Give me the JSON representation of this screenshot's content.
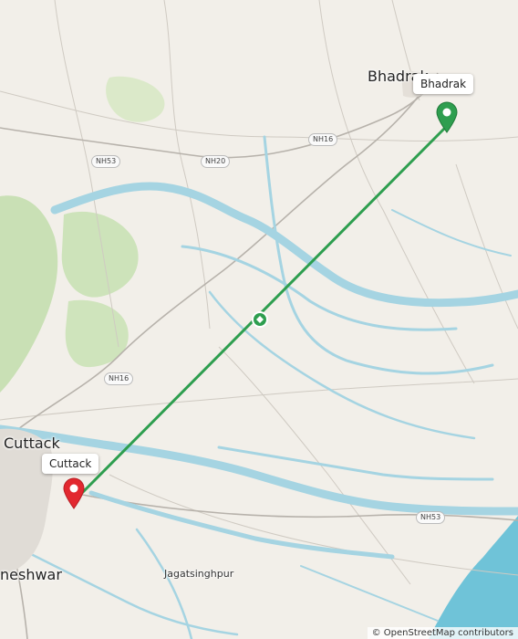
{
  "map": {
    "places": [
      {
        "id": "bhadrak-city",
        "label": "Bhadrak"
      },
      {
        "id": "cuttack-city",
        "label": "Cuttack"
      },
      {
        "id": "bhubaneswar-city",
        "label": "neshwar"
      },
      {
        "id": "jagatsinghpur-town",
        "label": "Jagatsinghpur"
      }
    ],
    "shields": [
      "NH16",
      "NH53",
      "NH20",
      "NH16",
      "NH53"
    ],
    "route": {
      "start_label": "Cuttack",
      "end_label": "Bhadrak",
      "color": "#2e9e4f"
    },
    "colors": {
      "land": "#f2efe9",
      "water": "#a5d4e2",
      "sea": "#6fc3d8",
      "forest": "#c8dfb3",
      "road": "#ffffff",
      "road_major": "#f7d9a0"
    },
    "attribution": "© OpenStreetMap contributors"
  }
}
